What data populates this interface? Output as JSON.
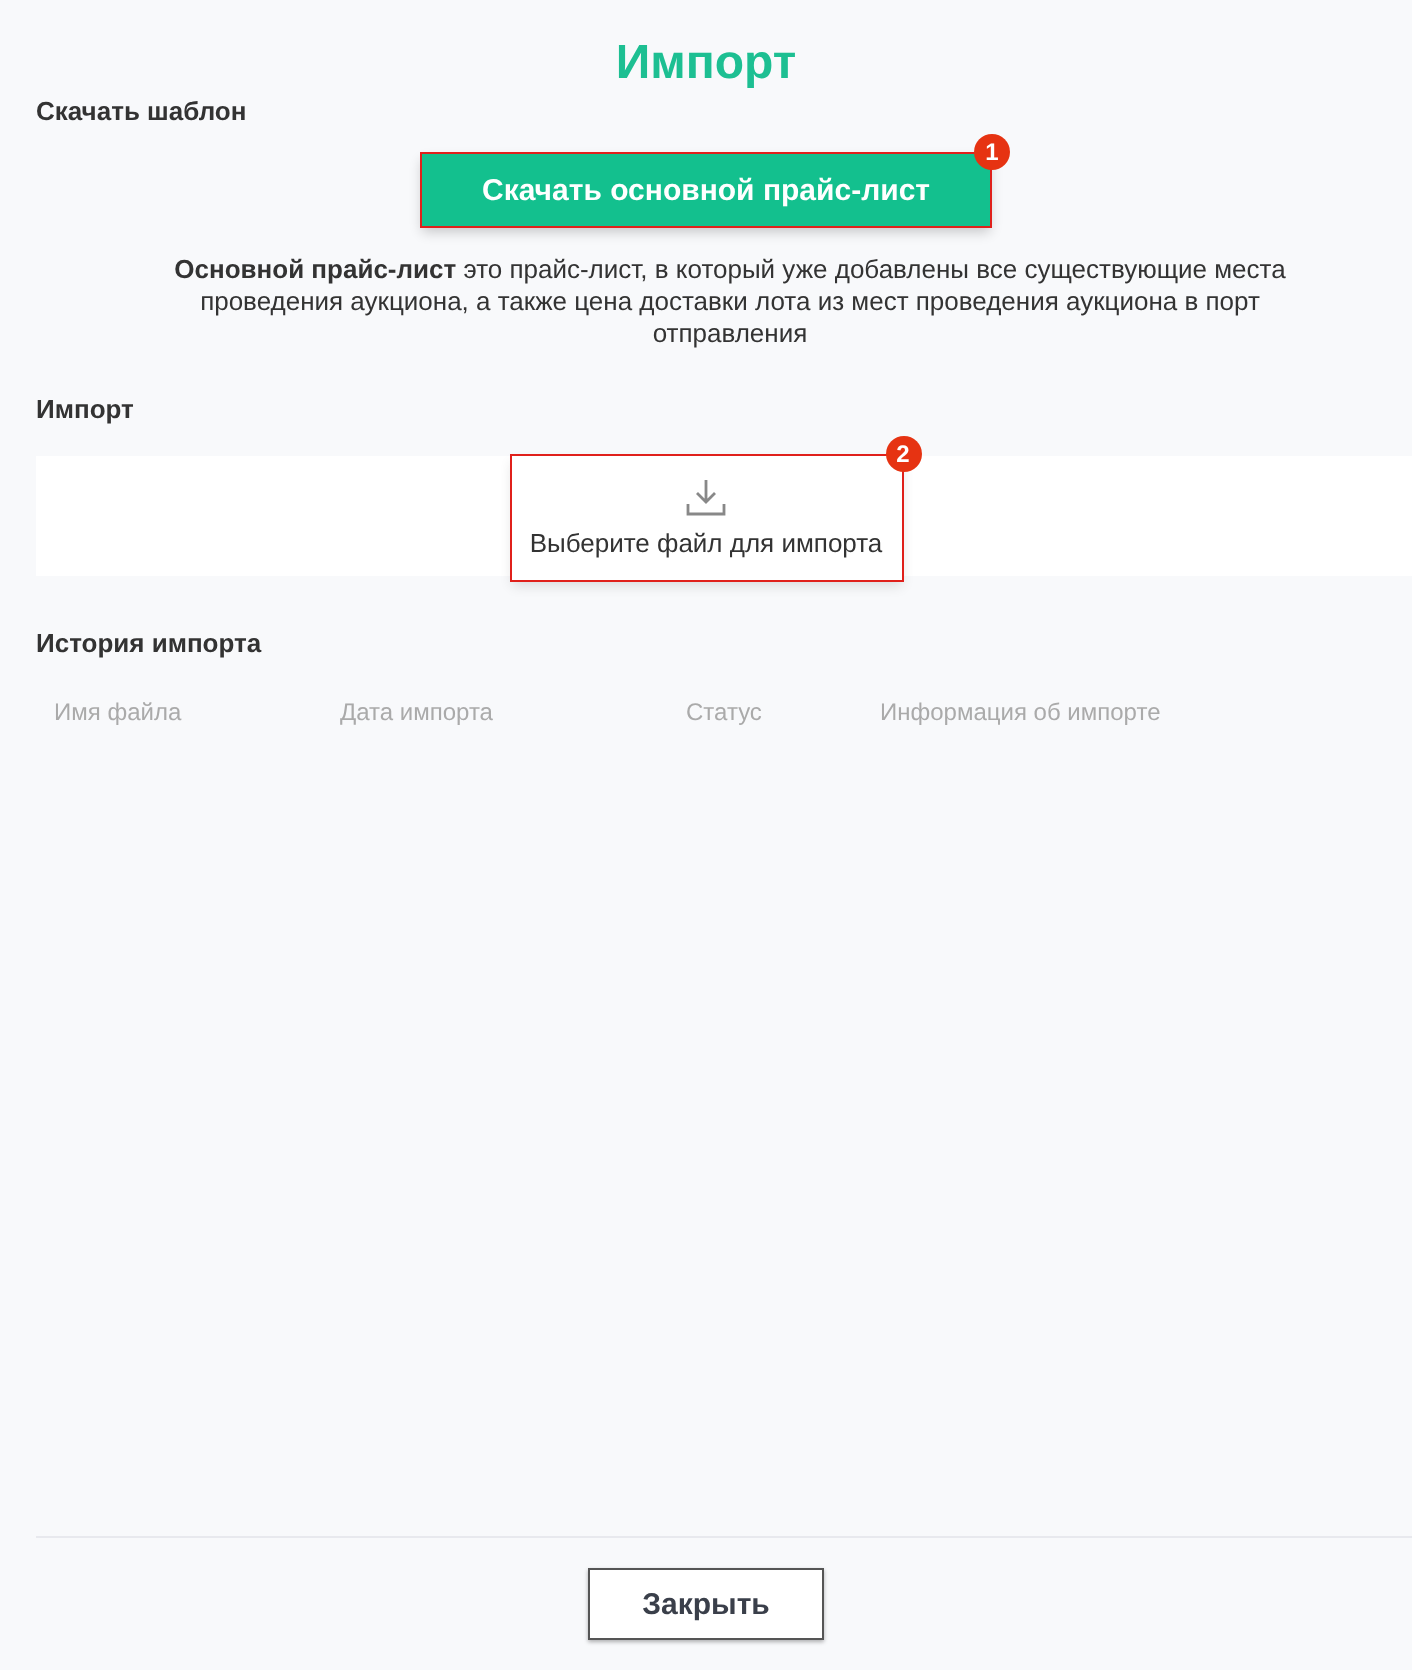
{
  "title": "Импорт",
  "template": {
    "heading": "Скачать шаблон",
    "button": "Скачать основной прайс-лист",
    "button_marker": "1",
    "description": "**Основной прайс-лист** это прайс-лист, в который уже добавлены все существующие места проведения аукциона, а также цена доставки лота из мест проведения аукциона в порт отправления"
  },
  "import": {
    "heading": "Импорт",
    "dropzone_label": "Выберите файл для импорта",
    "dropzone_marker": "2"
  },
  "history": {
    "heading": "История импорта",
    "columns": [
      "Имя файла",
      "Дата импорта",
      "Статус",
      "Информация об импорте"
    ]
  },
  "footer": {
    "close_button": "Закрыть"
  }
}
